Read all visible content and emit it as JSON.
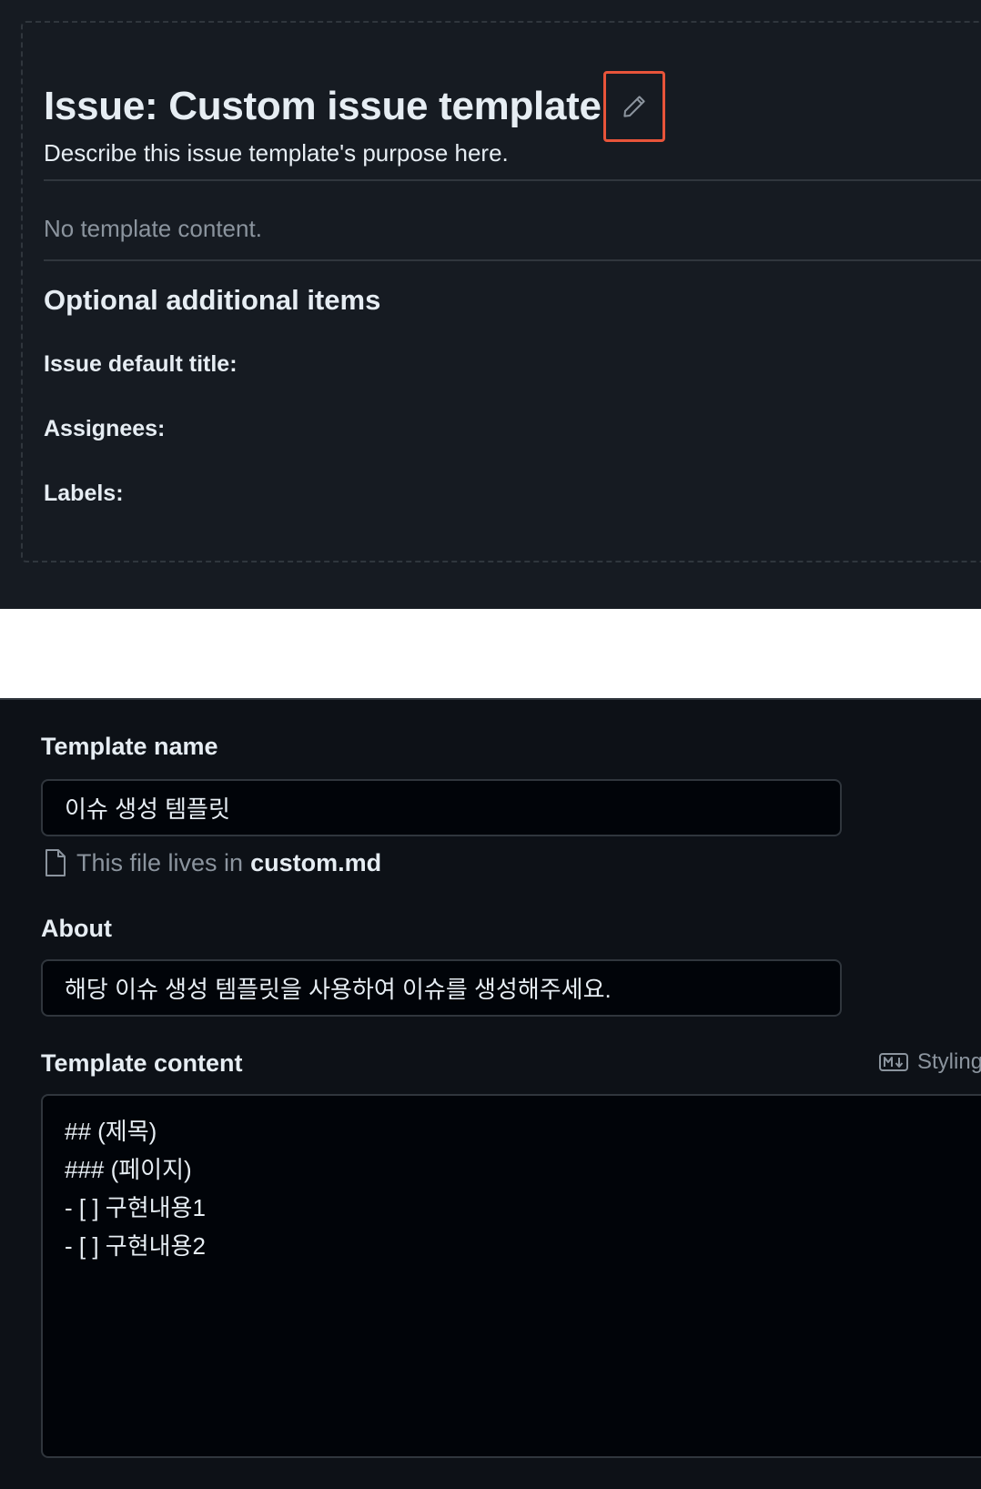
{
  "preview": {
    "title": "Issue: Custom issue template",
    "edit_icon": "pencil-icon",
    "highlight_color": "#e8543a",
    "description": "Describe this issue template's purpose here.",
    "no_content": "No template content.",
    "optional_heading": "Optional additional items",
    "fields": {
      "default_title": "Issue default title:",
      "assignees": "Assignees:",
      "labels": "Labels:"
    }
  },
  "form": {
    "template_name_label": "Template name",
    "template_name_value": "이슈 생성 템플릿",
    "file_note_prefix": "This file lives in",
    "file_name": "custom.md",
    "about_label": "About",
    "about_value": "해당 이슈 생성 템플릿을 사용하여 이슈를 생성해주세요.",
    "content_label": "Template content",
    "styling_label": "Styling",
    "content_lines": [
      "## (제목)",
      "### (페이지)",
      "- [ ] 구현내용1",
      "- [ ] 구현내용2"
    ]
  }
}
